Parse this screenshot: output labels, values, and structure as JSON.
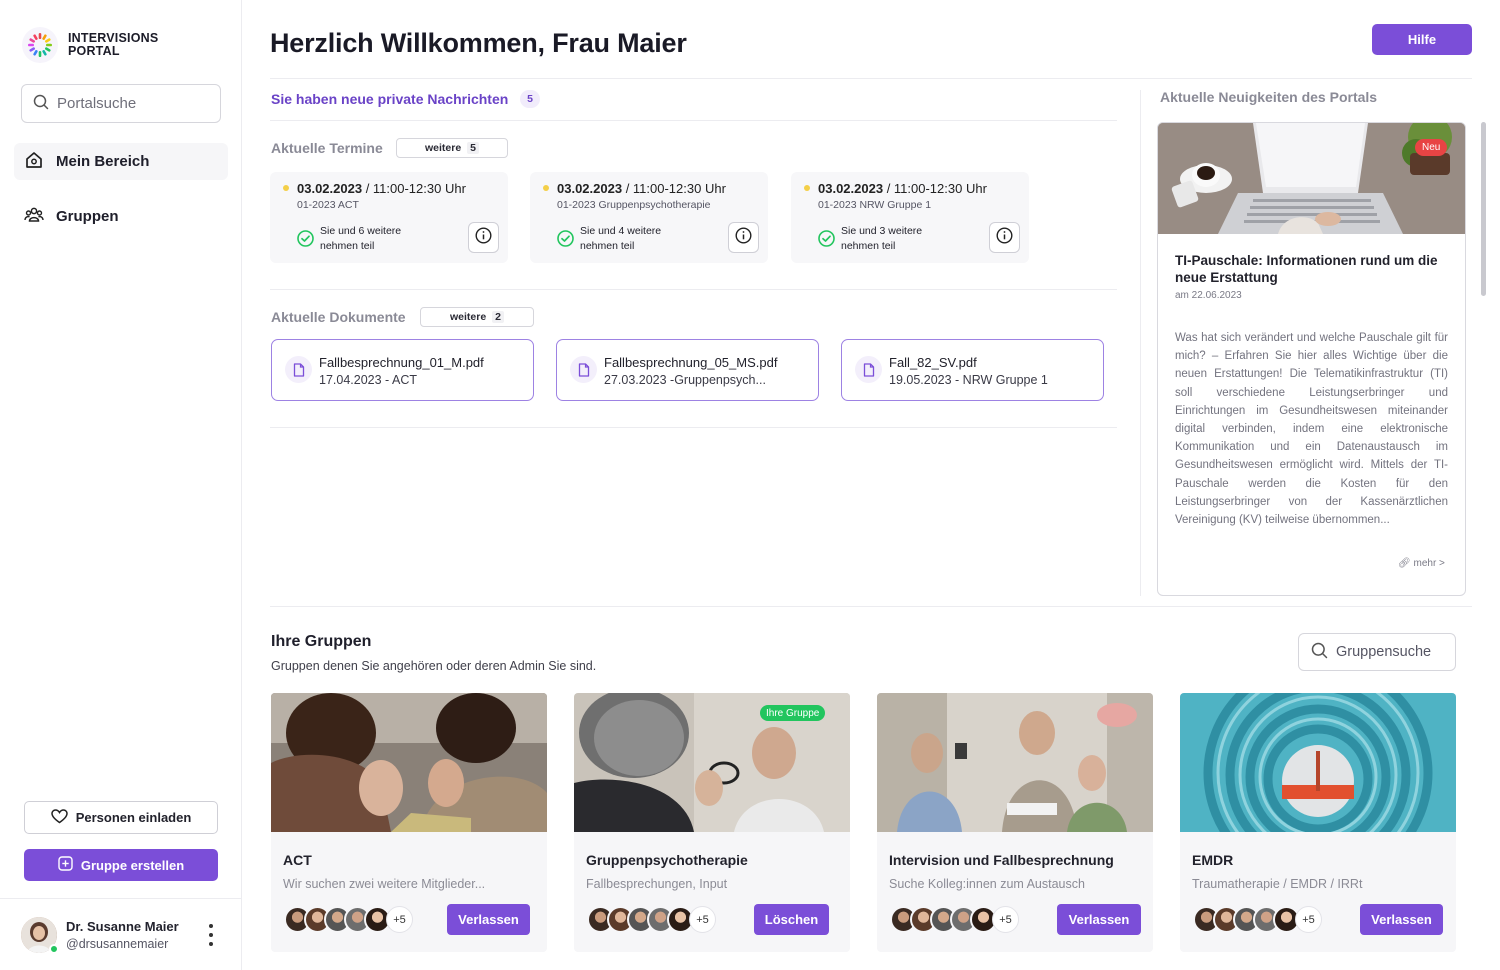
{
  "brand": {
    "line1": "INTERVISIONS",
    "line2": "PORTAL"
  },
  "sidebar": {
    "search_placeholder": "Portalsuche",
    "items": [
      {
        "label": "Mein Bereich",
        "icon": "home-icon"
      },
      {
        "label": "Gruppen",
        "icon": "users-icon"
      }
    ],
    "invite_label": "Personen einladen",
    "create_group_label": "Gruppe erstellen",
    "user": {
      "name": "Dr. Susanne Maier",
      "handle": "@drsusannemaier"
    }
  },
  "header": {
    "title": "Herzlich Willkommen, Frau Maier",
    "help_label": "Hilfe"
  },
  "messages": {
    "label": "Sie haben neue private Nachrichten",
    "count": "5"
  },
  "appointments": {
    "label": "Aktuelle Termine",
    "more_label": "weitere",
    "more_count": "5",
    "items": [
      {
        "date": "03.02.2023",
        "time": " / 11:00-12:30 Uhr",
        "group": "01-2023 ACT",
        "participants": "Sie und 6 weitere nehmen teil"
      },
      {
        "date": "03.02.2023",
        "time": " / 11:00-12:30 Uhr",
        "group": "01-2023 Gruppenpsychotherapie",
        "participants": "Sie und 4 weitere nehmen teil"
      },
      {
        "date": "03.02.2023",
        "time": " / 11:00-12:30 Uhr",
        "group": "01-2023 NRW Gruppe 1",
        "participants": "Sie und 3 weitere nehmen teil"
      }
    ]
  },
  "documents": {
    "label": "Aktuelle Dokumente",
    "more_label": "weitere",
    "more_count": "2",
    "items": [
      {
        "name": "Fallbesprechnung_01_M.pdf",
        "meta": "17.04.2023 - ACT"
      },
      {
        "name": "Fallbesprechnung_05_MS.pdf",
        "meta": "27.03.2023 -Gruppenpsych..."
      },
      {
        "name": "Fall_82_SV.pdf",
        "meta": "19.05.2023 - NRW Gruppe 1"
      }
    ]
  },
  "news": {
    "heading": "Aktuelle Neuigkeiten des Portals",
    "badge": "Neu",
    "title": "TI-Pauschale: Informationen rund um die neue Erstattung",
    "date": "am 22.06.2023",
    "body": "Was hat sich verändert und welche Pauschale gilt für mich? – Erfahren Sie hier alles Wichtige über die neuen Erstattungen! Die Telematikinfrastruktur (TI) soll verschiedene Leistungserbringer und Einrichtungen im Gesundheitswesen miteinander digital verbinden, indem eine elektronische Kommunikation und ein Datenaustausch im Gesundheitswesen ermöglicht wird. Mittels der TI-Pauschale werden die Kosten für den Leistungserbringer von der Kassenärztlichen Vereinigung (KV) teilweise übernommen...",
    "more": "mehr >"
  },
  "groups": {
    "title": "Ihre Gruppen",
    "subtitle": "Gruppen denen Sie angehören oder deren Admin Sie sind.",
    "search_placeholder": "Gruppensuche",
    "own_tag": "Ihre Gruppe",
    "items": [
      {
        "name": "ACT",
        "desc": "Wir suchen zwei weitere Mitglieder...",
        "extra": "+5",
        "action": "Verlassen"
      },
      {
        "name": "Gruppenpsychotherapie",
        "desc": "Fallbesprechungen, Input",
        "extra": "+5",
        "action": "Löschen"
      },
      {
        "name": "Intervision und Fallbesprechnung",
        "desc": "Suche Kolleg:innen zum Austausch",
        "extra": "+5",
        "action": "Verlassen"
      },
      {
        "name": "EMDR",
        "desc": "Traumatherapie / EMDR / IRRt",
        "extra": "+5",
        "action": "Verlassen"
      }
    ]
  },
  "colors": {
    "accent": "#7b4ed8",
    "success": "#22c55e",
    "badge_new": "#e84444",
    "appointment_dot": "#f4cf48"
  }
}
